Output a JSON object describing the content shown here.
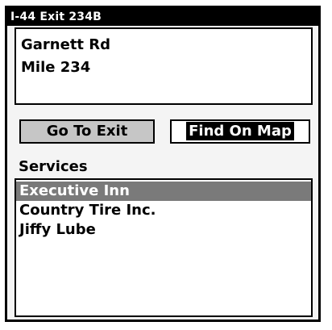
{
  "window": {
    "title": "I-44 Exit 234B"
  },
  "info": {
    "lines": [
      "Garnett Rd",
      "Mile 234"
    ]
  },
  "buttons": {
    "go_to_exit": "Go To Exit",
    "find_on_map": "Find On Map"
  },
  "services": {
    "label": "Services",
    "items": [
      {
        "label": "Executive Inn",
        "selected": true
      },
      {
        "label": "Country Tire Inc.",
        "selected": false
      },
      {
        "label": "Jiffy Lube",
        "selected": false
      }
    ]
  },
  "colors": {
    "title_bar": "#000000",
    "selection": "#7a7a7a",
    "button_inactive": "#c6c6c6",
    "button_focus": "#000000"
  }
}
